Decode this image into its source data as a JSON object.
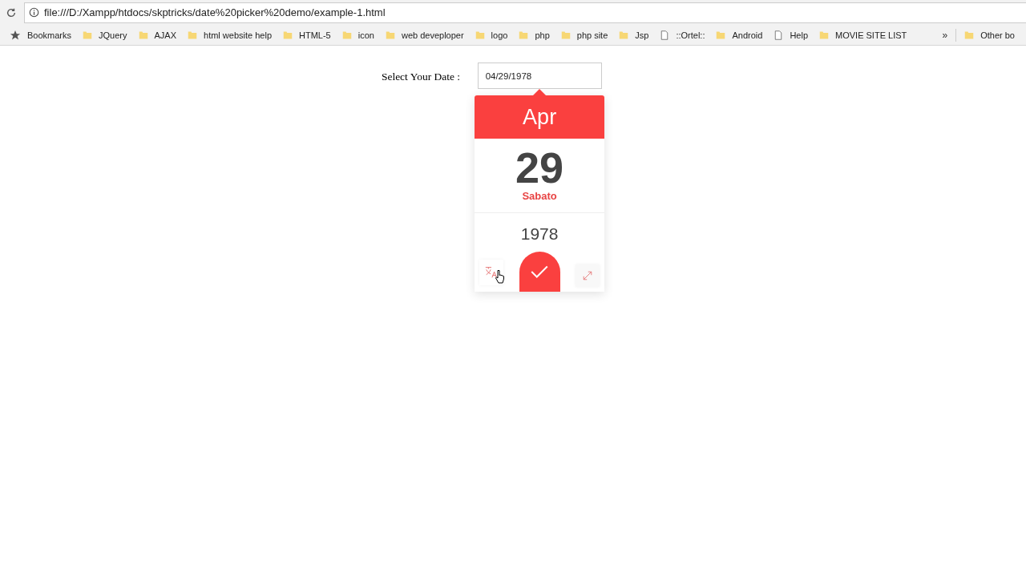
{
  "address_bar": {
    "url": "file:///D:/Xampp/htdocs/skptricks/date%20picker%20demo/example-1.html"
  },
  "bookmarks_bar": {
    "items": [
      {
        "label": "Bookmarks",
        "kind": "star"
      },
      {
        "label": "JQuery",
        "kind": "folder"
      },
      {
        "label": "AJAX",
        "kind": "folder"
      },
      {
        "label": "html website help",
        "kind": "folder"
      },
      {
        "label": "HTML-5",
        "kind": "folder"
      },
      {
        "label": "icon",
        "kind": "folder"
      },
      {
        "label": "web deveploper",
        "kind": "folder"
      },
      {
        "label": "logo",
        "kind": "folder"
      },
      {
        "label": "php",
        "kind": "folder"
      },
      {
        "label": "php site",
        "kind": "folder"
      },
      {
        "label": "Jsp",
        "kind": "folder"
      },
      {
        "label": "::Ortel::",
        "kind": "page"
      },
      {
        "label": "Android",
        "kind": "folder"
      },
      {
        "label": "Help",
        "kind": "page"
      },
      {
        "label": "MOVIE SITE LIST",
        "kind": "folder"
      }
    ],
    "overflow": "»",
    "other": "Other bo"
  },
  "form": {
    "label": "Select Your Date :",
    "value": "04/29/1978"
  },
  "date_picker": {
    "month": "Apr",
    "day": "29",
    "weekday": "Sabato",
    "year": "1978"
  }
}
